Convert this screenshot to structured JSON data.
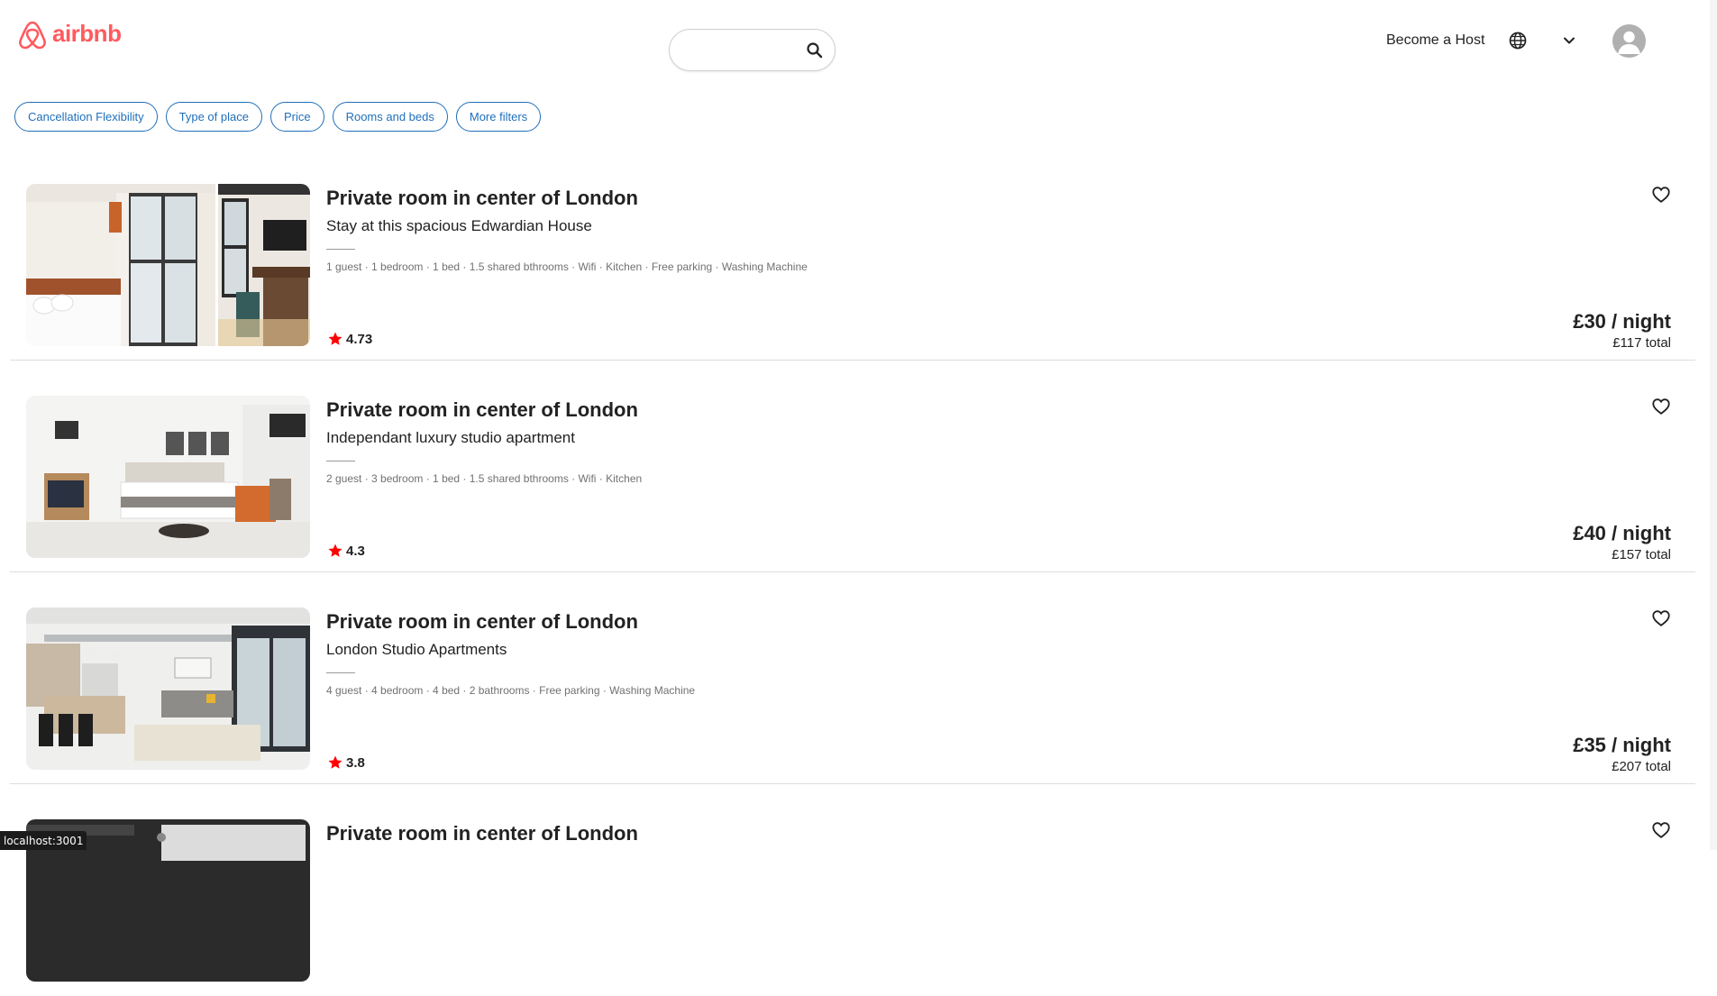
{
  "brand": {
    "name": "airbnb",
    "color": "#ff5a5f"
  },
  "header": {
    "search_placeholder": "",
    "become_host_label": "Become a Host",
    "globe_icon": "globe-icon",
    "chevron_icon": "chevron-down-icon",
    "avatar_icon": "user-avatar-icon"
  },
  "filters": [
    "Cancellation Flexibility",
    "Type of place",
    "Price",
    "Rooms and beds",
    "More filters"
  ],
  "accent_color": "#1f6fba",
  "listings": [
    {
      "title": "Private room in center of London",
      "subtitle": "Stay at this spacious Edwardian House",
      "amenities": "1 guest · 1 bedroom · 1 bed · 1.5 shared bthrooms · Wifi · Kitchen · Free parking · Washing Machine",
      "rating": "4.73",
      "price": "£30 / night",
      "total": "£117 total",
      "photo": "bedroom with tall windows and kitchenette"
    },
    {
      "title": "Private room in center of London",
      "subtitle": "Independant luxury studio apartment",
      "amenities": "2 guest · 3 bedroom · 1 bed · 1.5 shared bthrooms · Wifi · Kitchen",
      "rating": "4.3",
      "price": "£40 / night",
      "total": "£157 total",
      "photo": "white studio bedroom with orange chair"
    },
    {
      "title": "Private room in center of London",
      "subtitle": "London Studio Apartments",
      "amenities": "4 guest · 4 bedroom · 4 bed · 2 bathrooms · Free parking · Washing Machine",
      "rating": "3.8",
      "price": "£35 / night",
      "total": "£207 total",
      "photo": "open kitchen and living room with window wall"
    },
    {
      "title": "Private room in center of London",
      "subtitle": "",
      "amenities": "",
      "rating": "",
      "price": "",
      "total": "",
      "photo": "dark apartment interior"
    }
  ],
  "status_bar": "localhost:3001"
}
